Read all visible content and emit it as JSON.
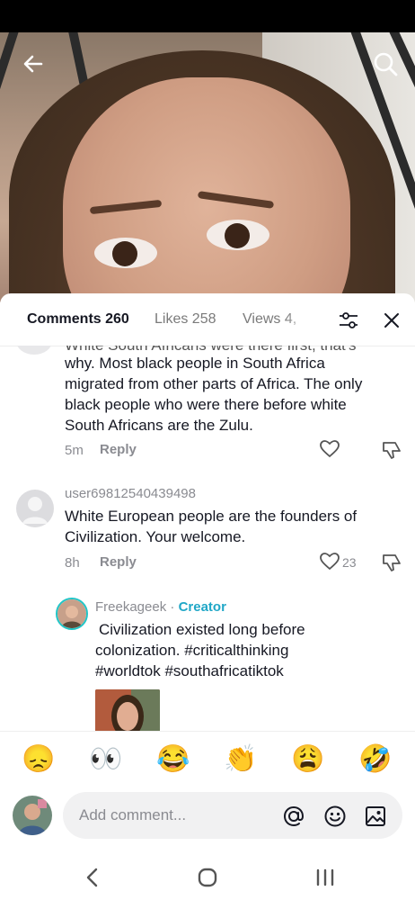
{
  "tabs": {
    "comments": "Comments 260",
    "likes": "Likes 258",
    "views": "Views 4,"
  },
  "comments": [
    {
      "partial_top": "White South Africans were there first, that's",
      "lines": [
        "why. Most black people in South Africa",
        "migrated from other parts of Africa. The only",
        "black people who were there before white",
        "South Africans are the Zulu."
      ],
      "time": "5m",
      "reply": "Reply"
    },
    {
      "username": "user69812540439498",
      "lines": [
        "White European people are the founders of",
        "Civilization. Your welcome."
      ],
      "time": "8h",
      "reply": "Reply",
      "likes": "23"
    },
    {
      "username": "Freekageek",
      "separator": " · ",
      "badge": "Creator",
      "lines": [
        "Civilization existed long before",
        "colonization.  #criticalthinking",
        "#worldtok  #southafricatiktok"
      ]
    }
  ],
  "emojis": [
    "😞",
    "👀",
    "😂",
    "👏",
    "😩",
    "🤣"
  ],
  "input": {
    "placeholder": "Add comment..."
  },
  "icons": {
    "back": "arrow-left-icon",
    "search": "search-icon",
    "filter": "sliders-icon",
    "close": "close-icon",
    "like": "heart-icon",
    "dislike": "thumbs-down-icon",
    "mention": "at-icon",
    "emoji": "smiley-icon",
    "image": "image-icon"
  },
  "colors": {
    "accent": "#20a7c7",
    "muted": "#8a8b91"
  }
}
